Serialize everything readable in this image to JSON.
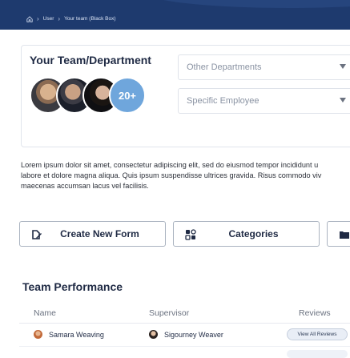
{
  "breadcrumb": {
    "items": [
      "User",
      "Your team (Black Box)"
    ]
  },
  "team_card": {
    "title": "Your Team/Department",
    "more_count": "20+",
    "other_departments_placeholder": "Other Departments",
    "specific_employee_placeholder": "Specific Employee"
  },
  "description": {
    "line1": "Lorem ipsum dolor sit amet, consectetur adipiscing elit, sed do eiusmod tempor incididunt u",
    "line2": "labore et dolore magna aliqua. Quis ipsum suspendisse ultrices gravida. Risus commodo viv",
    "line3": "maecenas accumsan lacus vel facilisis."
  },
  "actions": {
    "create_form": "Create New Form",
    "categories": "Categories"
  },
  "team_performance": {
    "title": "Team Performance",
    "columns": [
      "Name",
      "Supervisor",
      "Reviews"
    ],
    "rows": [
      {
        "name": "Samara Weaving",
        "supervisor": "Sigourney Weaver",
        "reviews_action": "View All Reviews"
      }
    ]
  },
  "colors": {
    "header_bg": "#1e3a6e",
    "accent_blue": "#6fa6dc"
  },
  "icons": {
    "home": "home-icon",
    "form": "form-edit-icon",
    "categories": "categories-grid-icon"
  }
}
